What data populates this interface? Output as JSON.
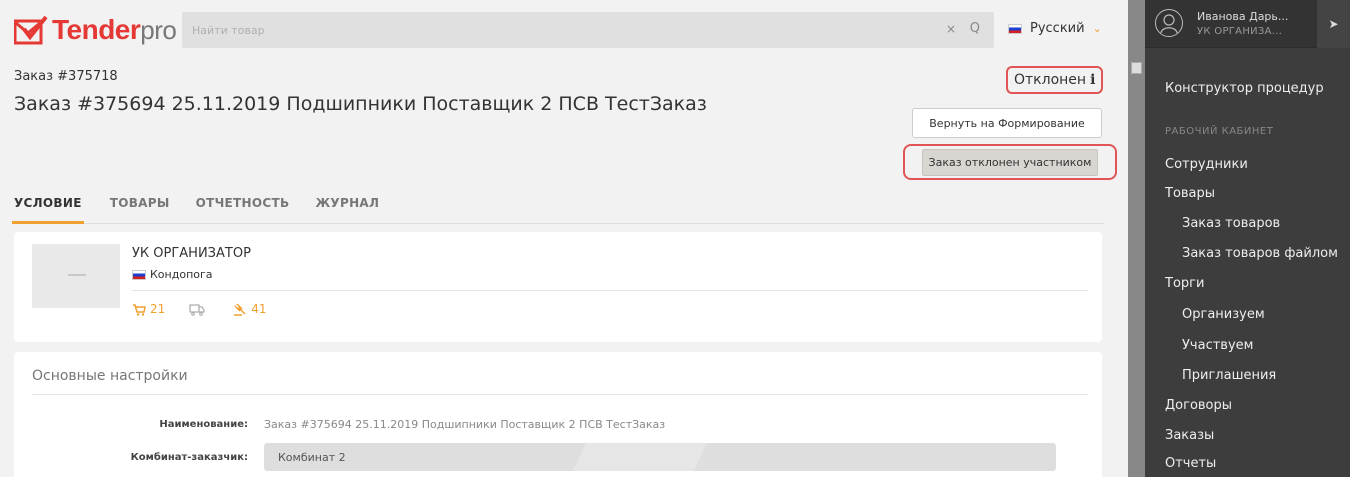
{
  "header": {
    "logo_main": "Tender",
    "logo_suffix": "pro",
    "search_placeholder": "Найти товар",
    "clear_glyph": "×",
    "search_glyph": "Q",
    "language": "Русский"
  },
  "order": {
    "number": "Заказ #375718",
    "title": "Заказ #375694 25.11.2019 Подшипники Поставщик 2 ПСВ ТестЗаказ",
    "status": "Отклонен",
    "status_info_glyph": "i",
    "return_button": "Вернуть на Формирование",
    "rejected_button": "Заказ отклонен участником"
  },
  "tabs": [
    {
      "label": "УСЛОВИЕ",
      "active": true
    },
    {
      "label": "ТОВАРЫ",
      "active": false
    },
    {
      "label": "ОТЧЕТНОСТЬ",
      "active": false
    },
    {
      "label": "ЖУРНАЛ",
      "active": false
    }
  ],
  "organization": {
    "name": "УК ОРГАНИЗАТОР",
    "city": "Кондопога",
    "stats": {
      "cart": "21",
      "truck": "",
      "auction": "41"
    }
  },
  "settings": {
    "section_title": "Основные настройки",
    "name_label": "Наименование:",
    "name_value": "Заказ #375694 25.11.2019 Подшипники Поставщик 2 ПСВ ТестЗаказ",
    "plant_label": "Комбинат-заказчик:",
    "plant_value": "Комбинат 2"
  },
  "user": {
    "name": "Иванова Дарь...",
    "org": "УК ОРГАНИЗА..."
  },
  "sidebar": {
    "constructor": "Конструктор процедур",
    "section": "РАБОЧИЙ КАБИНЕТ",
    "employees": "Сотрудники",
    "goods": "Товары",
    "order_goods": "Заказ товаров",
    "order_goods_file": "Заказ товаров файлом",
    "trades": "Торги",
    "organize": "Организуем",
    "participate": "Участвуем",
    "invitations": "Приглашения",
    "contracts": "Договоры",
    "orders": "Заказы",
    "reports": "Отчеты"
  },
  "colors": {
    "brand": "#e53935",
    "accent": "#f0a030",
    "highlight": "#e05555",
    "sidebar_bg": "#3d3d3d"
  }
}
